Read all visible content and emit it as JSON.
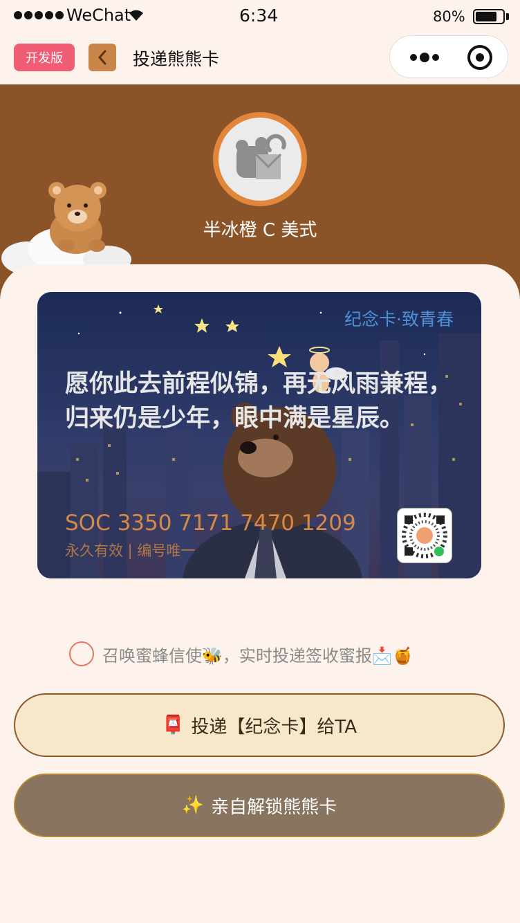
{
  "status_bar": {
    "carrier": "WeChat",
    "time": "6:34",
    "battery": "80%",
    "battery_level": 0.8
  },
  "nav": {
    "dev_badge": "开发版",
    "title": "投递熊熊卡",
    "back_icon": "chevron-left-icon",
    "more_icon": "more-dots-icon",
    "close_icon": "target-close-icon"
  },
  "profile": {
    "username": "半冰橙 C 美式"
  },
  "card": {
    "label": "纪念卡·致青春",
    "quote": "愿你此去前程似锦，再无风雨兼程，归来仍是少年，眼中满是星辰。",
    "number": "SOC 3350 7171 7470 1209",
    "subtitle": "永久有效 | 编号唯一"
  },
  "option": {
    "text": "召唤蜜蜂信使🐝，实时投递签收蜜报📩🍯",
    "checked": false
  },
  "buttons": {
    "deliver_icon": "📮",
    "deliver_label": "投递【纪念卡】给TA",
    "unlock_icon": "✨",
    "unlock_label": "亲自解锁熊熊卡"
  },
  "colors": {
    "header_brown": "#8a5428",
    "background": "#fdf3ec",
    "dev_badge": "#f05c74",
    "back_button": "#c98447",
    "avatar_ring": "#e2873a",
    "card_label": "#4e8fd6",
    "card_number": "#d58a47",
    "deliver_button": "#f7e7cb",
    "unlock_button": "#88745f"
  }
}
